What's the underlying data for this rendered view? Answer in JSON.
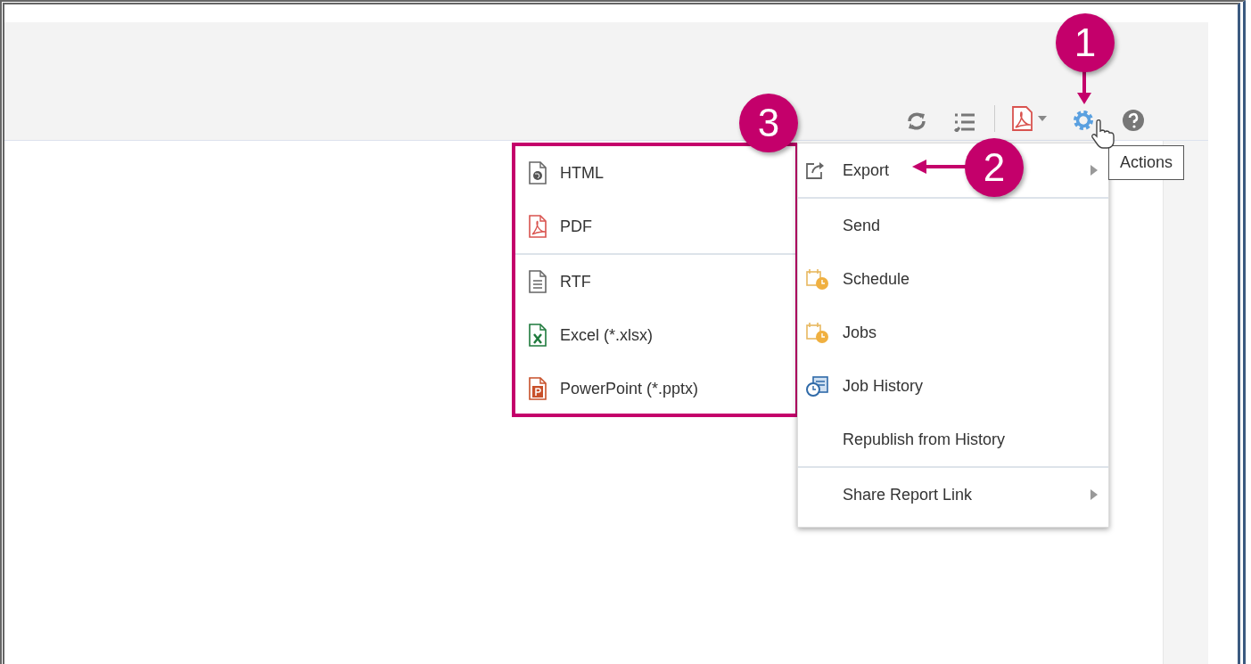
{
  "tooltip": {
    "text": "Actions"
  },
  "actions_menu": {
    "groups": [
      [
        {
          "label": "Export",
          "kind": "export",
          "submenu": true
        }
      ],
      [
        {
          "label": "Send",
          "kind": "plain",
          "submenu": false
        },
        {
          "label": "Schedule",
          "kind": "schedule",
          "submenu": false
        },
        {
          "label": "Jobs",
          "kind": "schedule",
          "submenu": false
        },
        {
          "label": "Job History",
          "kind": "history",
          "submenu": false
        },
        {
          "label": "Republish from History",
          "kind": "plain",
          "submenu": false
        }
      ],
      [
        {
          "label": "Share Report Link",
          "kind": "plain",
          "submenu": true
        }
      ]
    ]
  },
  "export_menu": {
    "groups": [
      [
        {
          "label": "HTML",
          "kind": "html"
        },
        {
          "label": "PDF",
          "kind": "pdf"
        }
      ],
      [
        {
          "label": "RTF",
          "kind": "rtf"
        },
        {
          "label": "Excel (*.xlsx)",
          "kind": "excel"
        },
        {
          "label": "PowerPoint (*.pptx)",
          "kind": "powerpoint"
        }
      ]
    ]
  },
  "callouts": [
    {
      "label": "1"
    },
    {
      "label": "2"
    },
    {
      "label": "3"
    }
  ]
}
